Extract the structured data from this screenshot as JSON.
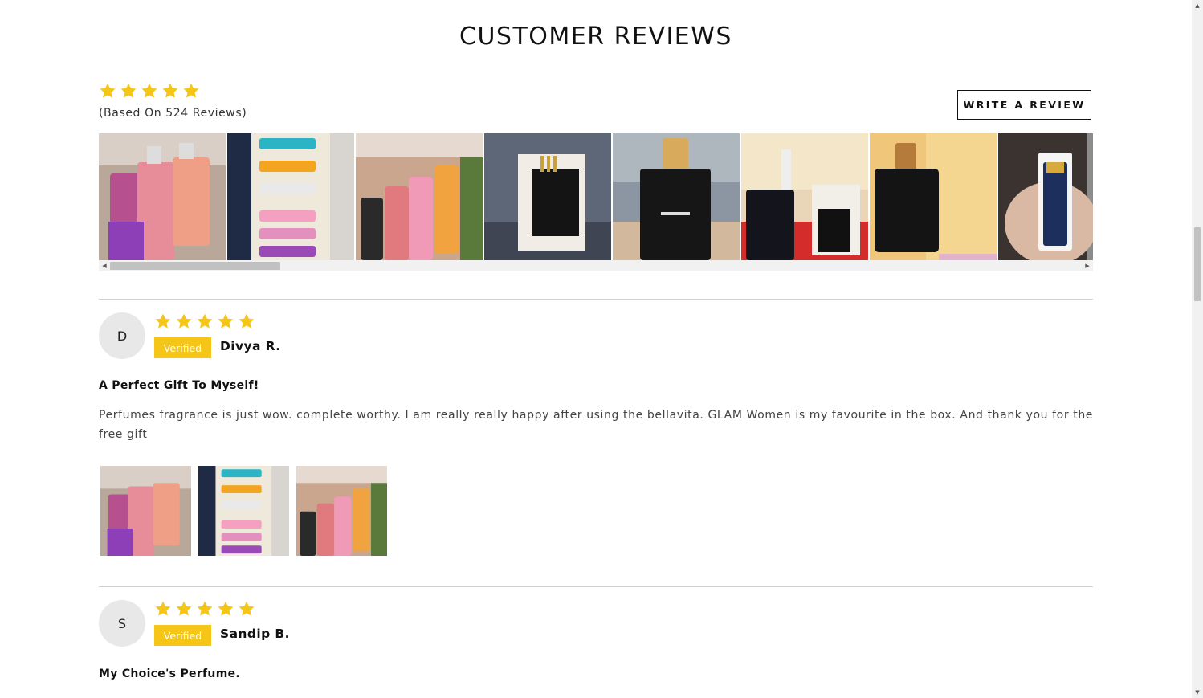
{
  "section": {
    "title": "CUSTOMER REVIEWS"
  },
  "summary": {
    "rating": 5,
    "based_on": "(Based On 524 Reviews)",
    "write_review_label": "WRITE A REVIEW"
  },
  "gallery": {
    "photos": [
      "perfume-pastel-bottles-photo",
      "perfume-gift-set-box-photo",
      "perfume-four-bottles-box-photo",
      "ceo-perfume-box-in-hand-photo",
      "bella-vita-ceo-bottle-photo",
      "perfume-bottles-and-boxes-photo",
      "ceo-eau-de-parfum-photo",
      "perfume-vial-in-hand-photo"
    ]
  },
  "reviews": [
    {
      "avatar_initial": "D",
      "rating": 5,
      "verified_label": "Verified",
      "reviewer": "Divya R.",
      "title": "A Perfect Gift To Myself!",
      "body": "Perfumes fragrance is just wow. complete worthy. I am really really happy after using the bellavita. GLAM Women is my favourite in the box. And thank you for the free gift",
      "photos": [
        "perfume-pastel-bottles-photo",
        "perfume-gift-set-box-photo",
        "perfume-four-bottles-box-photo"
      ]
    },
    {
      "avatar_initial": "S",
      "rating": 5,
      "verified_label": "Verified",
      "reviewer": "Sandip B.",
      "title": "My Choice's Perfume.",
      "body": "",
      "photos": []
    }
  ],
  "colors": {
    "star": "#f5c518",
    "verified_bg": "#f5c518",
    "divider": "#cfcfcf"
  },
  "icons": {
    "star": "star-icon",
    "scroll_left": "arrow-left-icon",
    "scroll_right": "arrow-right-icon"
  }
}
